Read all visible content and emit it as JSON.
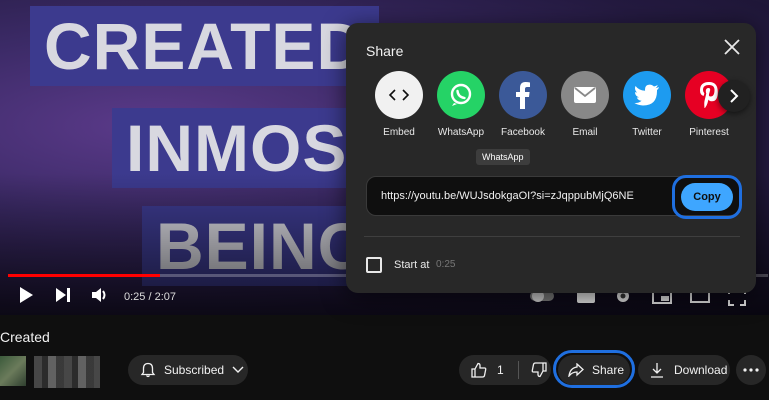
{
  "video": {
    "thumbnail_lines": [
      "CREATED",
      "INMOS",
      "BEINC"
    ],
    "time": "0:25 / 2:07",
    "progress_fraction": 0.2
  },
  "share_dialog": {
    "title": "Share",
    "targets": [
      {
        "label": "Embed",
        "icon": "embed-icon",
        "color": "#f1f1f1"
      },
      {
        "label": "WhatsApp",
        "icon": "whatsapp-icon",
        "color": "#25d366"
      },
      {
        "label": "Facebook",
        "icon": "facebook-icon",
        "color": "#3b5998"
      },
      {
        "label": "Email",
        "icon": "email-icon",
        "color": "#888888"
      },
      {
        "label": "Twitter",
        "icon": "twitter-icon",
        "color": "#1d9bf0"
      },
      {
        "label": "Pinterest",
        "icon": "pinterest-icon",
        "color": "#e60023"
      }
    ],
    "tooltip": "WhatsApp",
    "url": "https://youtu.be/WUJsdokgaOI?si=zJqppubMjQ6NE",
    "copy_label": "Copy",
    "start_at_label": "Start at",
    "start_at_time": "0:25"
  },
  "below": {
    "title": "Created",
    "subscribed_label": "Subscribed",
    "like_count": "1",
    "share_label": "Share",
    "download_label": "Download"
  },
  "colors": {
    "accent": "#3ea6ff",
    "highlight_ring": "#1f6fe0",
    "progress": "#ff0000"
  }
}
